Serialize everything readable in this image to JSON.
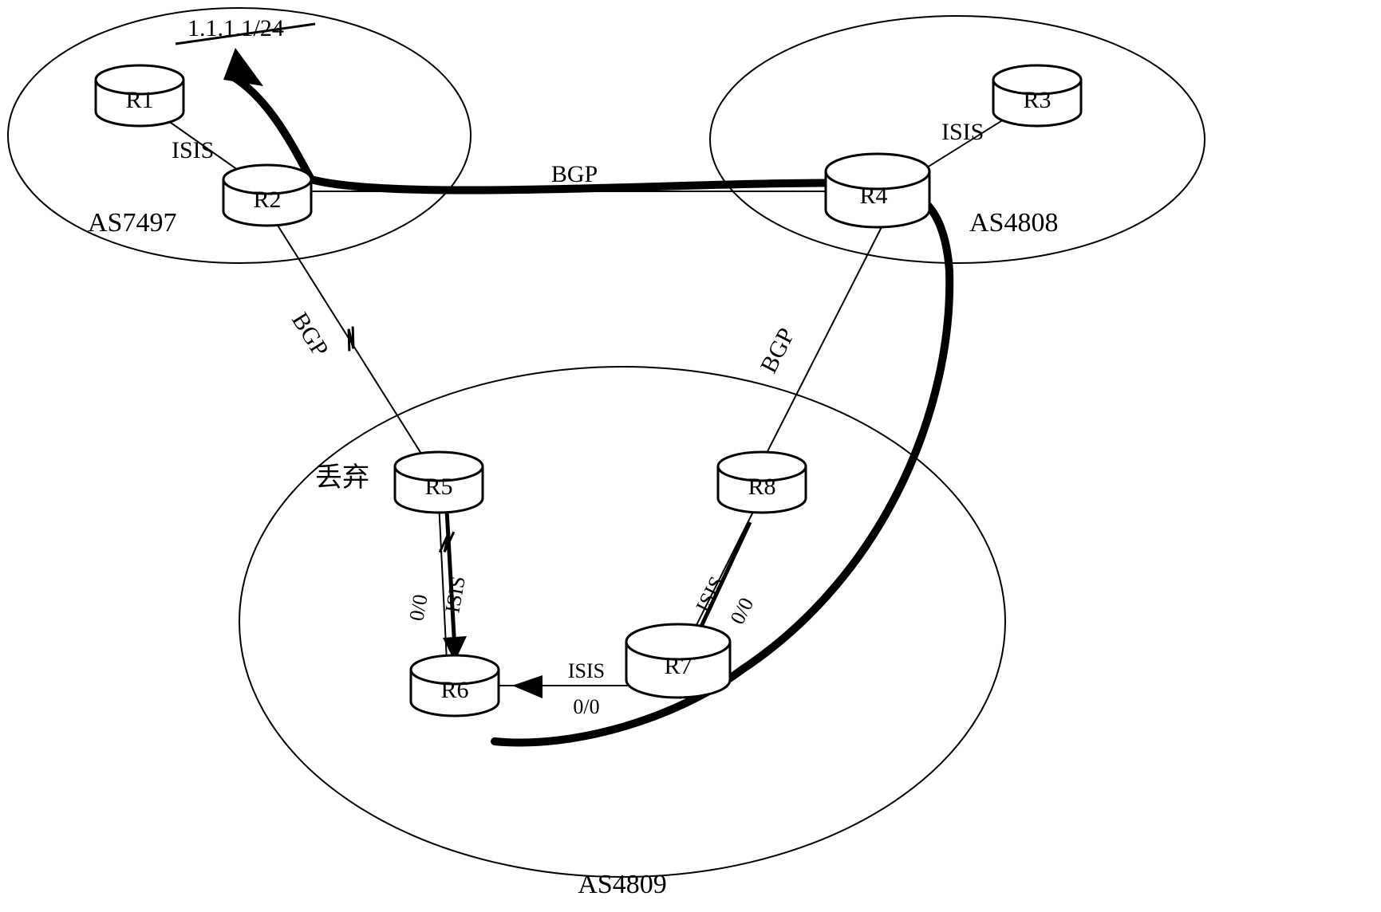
{
  "routers": {
    "r1": "R1",
    "r2": "R2",
    "r3": "R3",
    "r4": "R4",
    "r5": "R5",
    "r6": "R6",
    "r7": "R7",
    "r8": "R8"
  },
  "as_labels": {
    "a1": "AS7497",
    "a2": "AS4808",
    "a3": "AS4809"
  },
  "link_labels": {
    "r1r2": "ISIS",
    "r3r4": "ISIS",
    "r2r4": "BGP",
    "r2r5": "BGP",
    "r4r8": "BGP",
    "r5r6_p": "ISIS",
    "r5r6_r": "0/0",
    "r7r6_p": "ISIS",
    "r7r6_r": "0/0",
    "r8r7_p": "ISIS",
    "r8r7_r": "0/0"
  },
  "annotations": {
    "discard": "丢弃",
    "addr": "1.1.1.1/24"
  }
}
